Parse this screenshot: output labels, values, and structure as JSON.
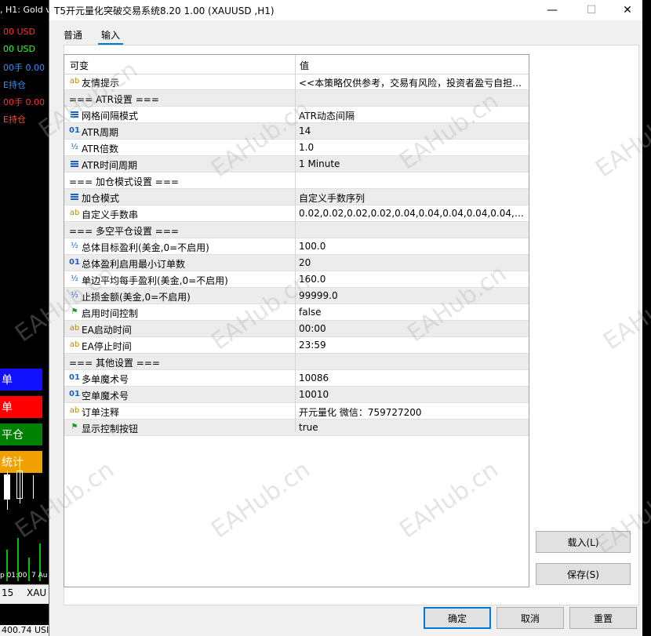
{
  "background": {
    "chart_header": ", H1:  Gold v",
    "lines": [
      {
        "text": "00  USD",
        "color": "#ff3030"
      },
      {
        "text": "00  USD",
        "color": "#30ff30"
      },
      {
        "text": "00手  0.00",
        "color": "#3a8cff"
      },
      {
        "text": "E持仓",
        "color": "#3a8cff"
      },
      {
        "text": "00手  0.00",
        "color": "#ff3030"
      },
      {
        "text": "E持仓",
        "color": "#ff5030"
      }
    ],
    "buttons": [
      {
        "label": "单",
        "color": "#1010ff"
      },
      {
        "label": "单",
        "color": "#ff0000"
      },
      {
        "label": "平仓",
        "color": "#008000"
      },
      {
        "label": "统计",
        "color": "#f0a000"
      }
    ],
    "time_labels": [
      "p 01:00",
      "7 Au"
    ],
    "tabs": [
      "15",
      "XAU"
    ],
    "bottom_text": "400.74 USI"
  },
  "window": {
    "title": "T5开元量化突破交易系统8.20 1.00 (XAUUSD ,H1)",
    "minimize": "—",
    "maximize": "☐",
    "close": "✕"
  },
  "tabs": [
    {
      "label": "普通",
      "active": false
    },
    {
      "label": "输入",
      "active": true
    }
  ],
  "grid": {
    "header": {
      "variable": "可变",
      "value": "值"
    },
    "rows": [
      {
        "icon": "ab",
        "name": "友情提示",
        "value": "<<本策略仅供参考，交易有风险，投资者盈亏自担>>"
      },
      {
        "icon": "",
        "name": "=== ATR设置 ===",
        "value": ""
      },
      {
        "icon": "list",
        "name": "网格间隔模式",
        "value": "ATR动态间隔"
      },
      {
        "icon": "01",
        "name": "ATR周期",
        "value": "14"
      },
      {
        "icon": "half",
        "name": "ATR倍数",
        "value": "1.0"
      },
      {
        "icon": "list",
        "name": "ATR时间周期",
        "value": "1 Minute"
      },
      {
        "icon": "",
        "name": "=== 加仓模式设置 ===",
        "value": ""
      },
      {
        "icon": "list",
        "name": "加仓模式",
        "value": "自定义手数序列"
      },
      {
        "icon": "ab",
        "name": "自定义手数串",
        "value": "0.02,0.02,0.02,0.02,0.04,0.04,0.04,0.04,0.04,0.04,0..."
      },
      {
        "icon": "",
        "name": "=== 多空平仓设置 ===",
        "value": ""
      },
      {
        "icon": "half",
        "name": "总体目标盈利(美金,0=不启用)",
        "value": "100.0"
      },
      {
        "icon": "01",
        "name": "总体盈利启用最小订单数",
        "value": "20"
      },
      {
        "icon": "half",
        "name": "单边平均每手盈利(美金,0=不启用)",
        "value": "160.0"
      },
      {
        "icon": "half",
        "name": "止损金额(美金,0=不启用)",
        "value": "99999.0"
      },
      {
        "icon": "flag",
        "name": "启用时间控制",
        "value": "false"
      },
      {
        "icon": "ab",
        "name": "EA启动时间",
        "value": "00:00"
      },
      {
        "icon": "ab",
        "name": "EA停止时间",
        "value": "23:59"
      },
      {
        "icon": "",
        "name": "=== 其他设置 ===",
        "value": ""
      },
      {
        "icon": "01",
        "name": "多单魔术号",
        "value": "10086"
      },
      {
        "icon": "01",
        "name": "空单魔术号",
        "value": "10010"
      },
      {
        "icon": "ab",
        "name": "订单注释",
        "value": "开元量化 微信：759727200"
      },
      {
        "icon": "flag",
        "name": "显示控制按钮",
        "value": "true"
      }
    ]
  },
  "side_buttons": {
    "load": "载入(L)",
    "save": "保存(S)"
  },
  "footer_buttons": {
    "ok": "确定",
    "cancel": "取消",
    "reset": "重置"
  },
  "watermark": "EAHub.cn"
}
